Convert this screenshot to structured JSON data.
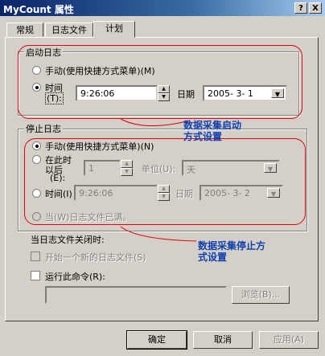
{
  "window": {
    "title": "MyCount 属性",
    "help_btn": "?",
    "close_btn": "X"
  },
  "tabs": [
    {
      "label": "常规"
    },
    {
      "label": "日志文件"
    },
    {
      "label": "计划"
    }
  ],
  "start_group": {
    "label": "启动日志",
    "manual": "手动(使用快捷方式菜单)(M)",
    "time_line1": "时间",
    "time_line2": "(T):",
    "time_value": "9:26:06",
    "date_label": "日期",
    "date_value": "2005- 3- 1"
  },
  "stop_group": {
    "label": "停止日志",
    "manual": "手动(使用快捷方式菜单)(N)",
    "after_line1": "在此时",
    "after_line2": "以后",
    "after_line3": "(E):",
    "after_value": "1",
    "unit_label": "单位(U):",
    "unit_value": "天",
    "time_label": "时间(I)",
    "time_value": "9:26:06",
    "date_label": "日期",
    "date_value": "2005- 3- 2",
    "when_full": "当(W)日志文件已满。"
  },
  "on_close": {
    "label": "当日志文件关闭时:",
    "start_new": "开始一个新的日志文件(S)",
    "run_command": "运行此命令(R):",
    "browse": "浏览(B)..."
  },
  "annotations": {
    "start_text_1": "数据采集启动",
    "start_text_2": "方式设置",
    "stop_text_1": "数据采集停止方",
    "stop_text_2": "式设置",
    "color": "#e0000e"
  },
  "buttons": {
    "ok": "确定",
    "cancel": "取消",
    "apply": "应用(A)"
  }
}
